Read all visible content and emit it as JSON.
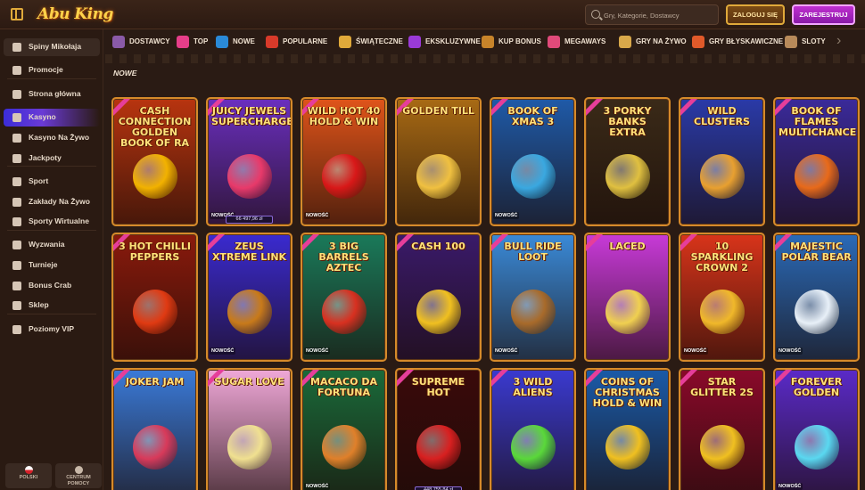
{
  "header": {
    "logo_text": "Abu King",
    "search_placeholder": "Gry, Kategorie, Dostawcy",
    "login_label": "ZALOGUJ SIĘ",
    "register_label": "ZAREJESTRUJ"
  },
  "sidebar": {
    "items": [
      {
        "label": "Spiny Mikołaja",
        "icon": "gift-icon"
      },
      {
        "label": "Promocje",
        "icon": "promo-icon"
      },
      {
        "label": "Strona główna",
        "icon": "home-icon"
      },
      {
        "label": "Kasyno",
        "icon": "casino-icon"
      },
      {
        "label": "Kasyno Na Żywo",
        "icon": "live-casino-icon"
      },
      {
        "label": "Jackpoty",
        "icon": "jackpot-icon"
      },
      {
        "label": "Sport",
        "icon": "sport-icon"
      },
      {
        "label": "Zakłady Na Żywo",
        "icon": "live-bet-icon"
      },
      {
        "label": "Sporty Wirtualne",
        "icon": "virtual-sport-icon"
      },
      {
        "label": "Wyzwania",
        "icon": "trophy-icon"
      },
      {
        "label": "Turnieje",
        "icon": "tournament-icon"
      },
      {
        "label": "Bonus Crab",
        "icon": "crab-icon"
      },
      {
        "label": "Sklep",
        "icon": "shop-icon"
      },
      {
        "label": "Poziomy VIP",
        "icon": "vip-icon"
      }
    ],
    "footer": {
      "language_label": "POLSKI",
      "help_label": "CENTRUM POMOCY"
    }
  },
  "categories": [
    {
      "label": "DOSTAWCY",
      "color": "#8a5aa8"
    },
    {
      "label": "TOP",
      "color": "#e63e8a"
    },
    {
      "label": "NOWE",
      "color": "#2a8ad8"
    },
    {
      "label": "POPULARNE",
      "color": "#d83a2a"
    },
    {
      "label": "ŚWIĄTECZNE",
      "color": "#e0a93a"
    },
    {
      "label": "EKSKLUZYWNE",
      "color": "#9a3ad8"
    },
    {
      "label": "KUP BONUS",
      "color": "#c8842a"
    },
    {
      "label": "MEGAWAYS",
      "color": "#e04a7a"
    },
    {
      "label": "GRY NA ŻYWO",
      "color": "#d8a84a"
    },
    {
      "label": "GRY BŁYSKAWICZNE",
      "color": "#e05a2a"
    },
    {
      "label": "SLOTY",
      "color": "#b88a5a"
    }
  ],
  "section_title": "NOWE",
  "games": [
    {
      "title": "Cash Connection Golden Book of Ra",
      "bg": "#b8340f",
      "art": "#f2b200",
      "new": false,
      "jackpot": ""
    },
    {
      "title": "Juicy Jewels Supercharged",
      "bg": "#6a2fbf",
      "art": "#e83a6a",
      "new": true,
      "jackpot": "66 497,96 zł"
    },
    {
      "title": "Wild Hot 40 Hold & Win",
      "bg": "#e0541a",
      "art": "#d81818",
      "new": true,
      "jackpot": ""
    },
    {
      "title": "Golden Till",
      "bg": "#a86a14",
      "art": "#f0c040",
      "new": false,
      "jackpot": ""
    },
    {
      "title": "Book of Xmas 3",
      "bg": "#1f5aa8",
      "art": "#3aa8e0",
      "new": true,
      "jackpot": ""
    },
    {
      "title": "3 Porky Banks Extra",
      "bg": "#3a2a18",
      "art": "#e0c040",
      "new": false,
      "jackpot": ""
    },
    {
      "title": "Wild Clusters",
      "bg": "#2a3aa8",
      "art": "#e8a030",
      "new": false,
      "jackpot": ""
    },
    {
      "title": "Book of Flames Multichance",
      "bg": "#3a2a9a",
      "art": "#e86a1a",
      "new": false,
      "jackpot": ""
    },
    {
      "title": "3 Hot Chilli Peppers",
      "bg": "#8a1a0c",
      "art": "#e03a12",
      "new": false,
      "jackpot": ""
    },
    {
      "title": "Zeus Xtreme Link",
      "bg": "#3a2ad0",
      "art": "#c87a1a",
      "new": true,
      "jackpot": ""
    },
    {
      "title": "3 Big Barrels Aztec",
      "bg": "#1a7a5a",
      "art": "#d83020",
      "new": true,
      "jackpot": ""
    },
    {
      "title": "Cash 100",
      "bg": "#3a1a6a",
      "art": "#f0c020",
      "new": false,
      "jackpot": ""
    },
    {
      "title": "Bull Ride Loot",
      "bg": "#3a8ad8",
      "art": "#a86a2a",
      "new": true,
      "jackpot": ""
    },
    {
      "title": "Laced",
      "bg": "#c83ad8",
      "art": "#f0d050",
      "new": false,
      "jackpot": ""
    },
    {
      "title": "10 Sparkling Crown 2",
      "bg": "#d8341a",
      "art": "#f0b82a",
      "new": true,
      "jackpot": ""
    },
    {
      "title": "Majestic Polar Bear",
      "bg": "#2a6ab8",
      "art": "#e8f0f8",
      "new": true,
      "jackpot": ""
    },
    {
      "title": "Joker Jam",
      "bg": "#3a7ad8",
      "art": "#d83a5a",
      "new": false,
      "jackpot": ""
    },
    {
      "title": "Sugar Love",
      "bg": "#f0a8d8",
      "art": "#f0e090",
      "new": false,
      "jackpot": ""
    },
    {
      "title": "Macaco da Fortuna",
      "bg": "#1a6a3a",
      "art": "#e0802a",
      "new": true,
      "jackpot": ""
    },
    {
      "title": "Supreme Hot",
      "bg": "#3a0a0a",
      "art": "#d82020",
      "new": false,
      "jackpot": "448 755,84 zł"
    },
    {
      "title": "3 Wild Aliens",
      "bg": "#3a3ad0",
      "art": "#5ad83a",
      "new": false,
      "jackpot": ""
    },
    {
      "title": "Coins of Christmas Hold & Win",
      "bg": "#1a5aa8",
      "art": "#f0c020",
      "new": false,
      "jackpot": ""
    },
    {
      "title": "Star Glitter 2s",
      "bg": "#8a0a2a",
      "art": "#f0c020",
      "new": false,
      "jackpot": ""
    },
    {
      "title": "Forever Golden",
      "bg": "#5a2ac8",
      "art": "#5ad8f0",
      "new": true,
      "jackpot": ""
    }
  ],
  "new_badge_label": "NOWOŚĆ"
}
